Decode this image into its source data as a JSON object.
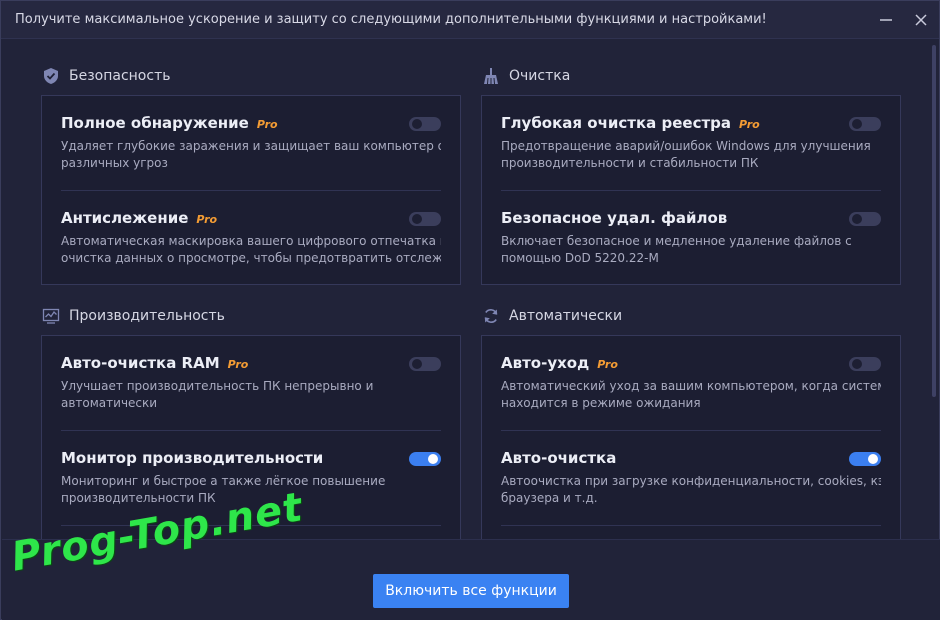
{
  "window": {
    "title": "Получите максимальное ускорение и защиту со следующими дополнительными функциями и настройками!"
  },
  "sections": {
    "security": {
      "label": "Безопасность",
      "icon": "shield-icon",
      "items": [
        {
          "title": "Полное обнаружение",
          "pro": "Pro",
          "desc": [
            "Удаляет глубокие заражения и защищает ваш компьютер от",
            "различных угроз"
          ],
          "enabled": false
        },
        {
          "title": "Антислежение",
          "pro": "Pro",
          "desc": [
            "Автоматическая маскировка вашего цифрового отпечатка и",
            "очистка данных о просмотре, чтобы предотвратить отслежив..."
          ],
          "enabled": false
        }
      ]
    },
    "cleaning": {
      "label": "Очистка",
      "icon": "broom-icon",
      "items": [
        {
          "title": "Глубокая очистка реестра",
          "pro": "Pro",
          "desc": [
            "Предотвращение аварий/ошибок  Windows  для улучшения",
            "производительности и стабильности ПК"
          ],
          "enabled": false
        },
        {
          "title": "Безопасное удал. файлов",
          "pro": "",
          "desc": [
            "Включает безопасное и медленное удаление файлов с",
            "помощью DoD 5220.22-M"
          ],
          "enabled": false
        }
      ]
    },
    "performance": {
      "label": "Производительность",
      "icon": "monitor-chart-icon",
      "items": [
        {
          "title": "Авто-очистка RAM",
          "pro": "Pro",
          "desc": [
            "Улучшает производительность ПК непрерывно и",
            "автоматически"
          ],
          "enabled": false
        },
        {
          "title": "Монитор производительности",
          "pro": "",
          "desc": [
            "Мониторинг и быстрое а также лёгкое повышение",
            "производительности ПК"
          ],
          "enabled": true
        }
      ]
    },
    "automatic": {
      "label": "Автоматически",
      "icon": "refresh-icon",
      "items": [
        {
          "title": "Авто-уход",
          "pro": "Pro",
          "desc": [
            "Автоматический уход за вашим компьютером, когда система",
            "находится в режиме ожидания"
          ],
          "enabled": false
        },
        {
          "title": "Авто-очистка",
          "pro": "",
          "desc": [
            "Автоочистка при загрузке конфиденциальности, cookies, кэша",
            "браузера и т.д."
          ],
          "enabled": true
        }
      ]
    }
  },
  "footer": {
    "enable_all_label": "Включить все функции"
  },
  "watermark": "Prog-Top.net",
  "colors": {
    "background": "#212339",
    "card": "#1c1e32",
    "accent": "#3a82f2",
    "pro": "#f39c34",
    "toggle_off": "#3b3e5c"
  }
}
